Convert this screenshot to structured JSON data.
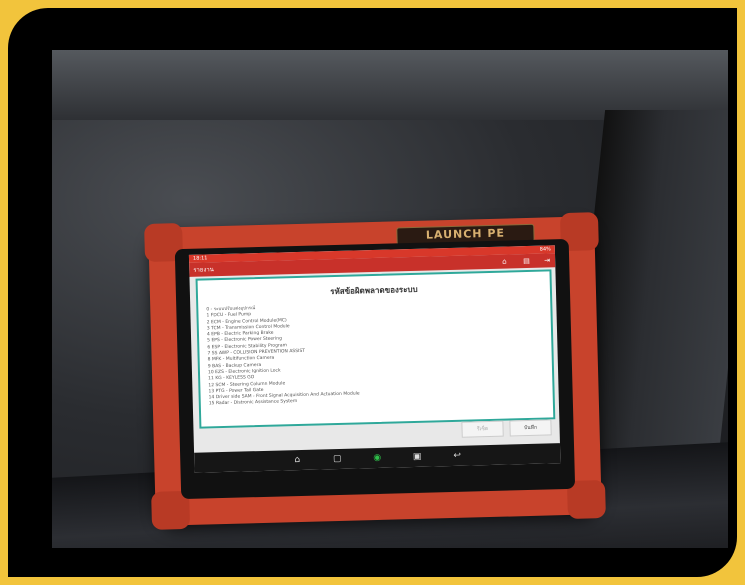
{
  "brand": "LAUNCH PE",
  "status": {
    "time": "18:11",
    "battery": "84%"
  },
  "titlebar": {
    "title": "รายงาน"
  },
  "panel": {
    "title": "รหัสข้อผิดพลาดของระบบ",
    "items": [
      "0 - ระบบปรับแต่งอุปกรณ์",
      "1 FDCU - Fuel Pump",
      "2 ECM - Engine Control Module(MC)",
      "3 TCM - Transmission Control Module",
      "4 EPB - Electric Parking Brake",
      "5 EPS - Electronic Power Steering",
      "6 ESP - Electronic Stability Program",
      "7 SS AWP - COLLISION PREVENTION ASSIST",
      "8 MFK - Multifunction Camera",
      "9 BAS - Backup Camera",
      "10 EZS - Electronic Ignition Lock",
      "11 KG - KEYLESS GO",
      "12 SCM - Steering Column Module",
      "13 PTG - Power Tail Gate",
      "14 Driver side SAM - Front Signal Acquisition And Actuation Module",
      "15 Radar - Distronic Assistance System"
    ]
  },
  "buttons": {
    "disabled": "รีเซ็ต",
    "save": "บันทึก"
  }
}
